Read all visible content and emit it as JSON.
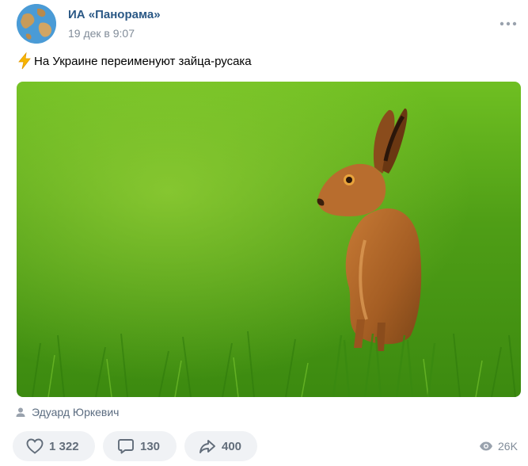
{
  "post": {
    "author": "ИА «Панорама»",
    "date": "19 дек в 9:07",
    "text": "На Украине переименуют зайца-русака",
    "photo_credit": "Эдуард Юркевич"
  },
  "icons": {
    "avatar": "globe-avatar",
    "more": "more-dots-icon",
    "bolt": "lightning-emoji-icon",
    "person": "person-icon",
    "like": "heart-icon",
    "comment": "comment-icon",
    "share": "share-icon",
    "views": "eye-icon"
  },
  "actions": {
    "likes": "1 322",
    "comments": "130",
    "shares": "400",
    "views": "26K"
  },
  "colors": {
    "author": "#2a5885",
    "secondary": "#818c99",
    "action_bg": "#f0f2f5",
    "action_text": "#626d7a"
  }
}
